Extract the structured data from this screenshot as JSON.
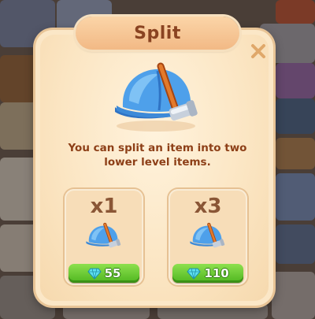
{
  "dialog": {
    "title": "Split",
    "description": "You can split an item into two lower level items.",
    "close_icon": "close-icon",
    "item_icon": "hard-hat-with-hammer-icon"
  },
  "options": [
    {
      "quantity": "x1",
      "price": "55",
      "currency_icon": "diamond-icon"
    },
    {
      "quantity": "x3",
      "price": "110",
      "currency_icon": "diamond-icon"
    }
  ],
  "colors": {
    "panel": "#fbe7c7",
    "title_text": "#8a4321",
    "description_text": "#8d3f17",
    "buy_button": "#5fc62a",
    "close_icon": "#e0a86a"
  }
}
